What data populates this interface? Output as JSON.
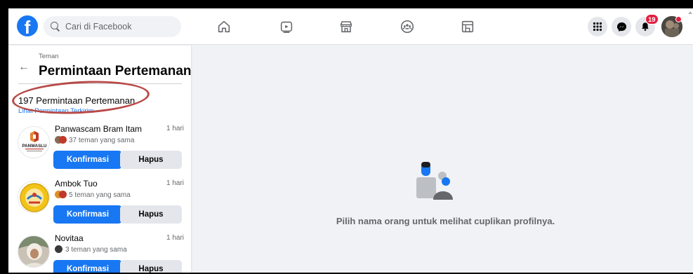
{
  "search": {
    "placeholder": "Cari di Facebook"
  },
  "notifications": {
    "count": "19"
  },
  "sidebar": {
    "breadcrumb": "Teman",
    "title": "Permintaan Pertemanan",
    "count_text": "197 Permintaan Pertemanan",
    "sent_link": "Lihat Permintaan Terkirim"
  },
  "requests": [
    {
      "name": "Panwascam Bram Itam",
      "time": "1 hari",
      "mutual": "37 teman yang sama",
      "confirm": "Konfirmasi",
      "delete": "Hapus",
      "avatar_text": "PANWASLU"
    },
    {
      "name": "Ambok Tuo",
      "time": "1 hari",
      "mutual": "5 teman yang sama",
      "confirm": "Konfirmasi",
      "delete": "Hapus"
    },
    {
      "name": "Novitaa",
      "time": "1 hari",
      "mutual": "3 teman yang sama",
      "confirm": "Konfirmasi",
      "delete": "Hapus"
    }
  ],
  "main": {
    "empty_message": "Pilih nama orang untuk melihat cuplikan profilnya."
  },
  "colors": {
    "brand": "#1877f2",
    "annotation": "#b84a48",
    "badge": "#e41e3f"
  },
  "icons": [
    "facebook-logo-icon",
    "search-icon",
    "home-icon",
    "watch-icon",
    "marketplace-icon",
    "groups-icon",
    "gaming-icon",
    "menu-grid-icon",
    "messenger-icon",
    "bell-icon"
  ]
}
